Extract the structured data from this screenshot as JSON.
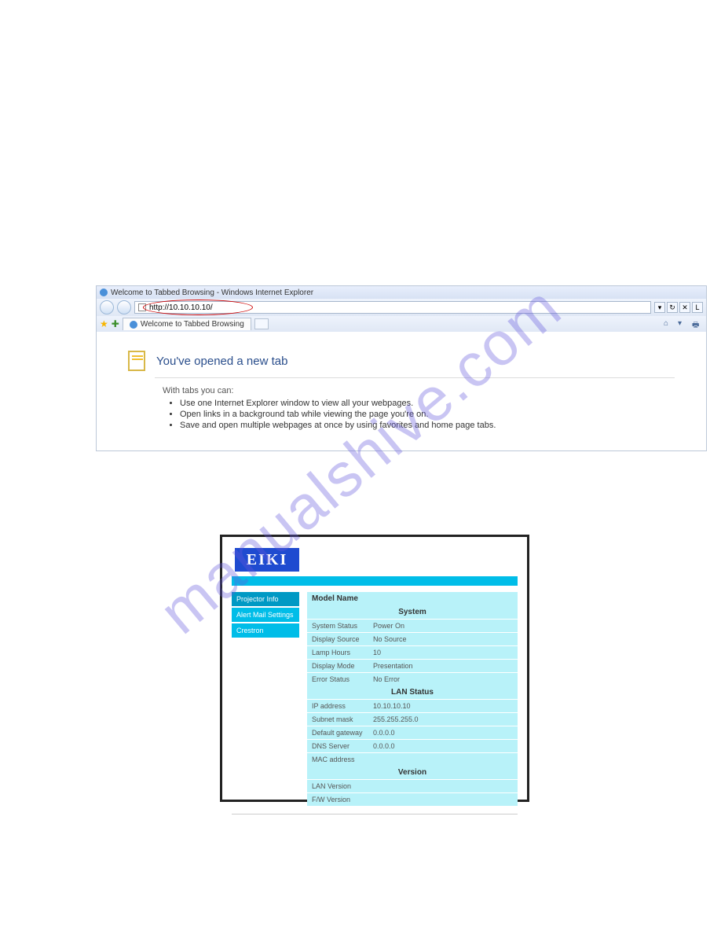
{
  "watermark": "manualshive.com",
  "browser": {
    "title": "Welcome to Tabbed Browsing - Windows Internet Explorer",
    "url": "http://10.10.10.10/",
    "refresh_icon": "↻",
    "stop_icon": "✕",
    "search_hint": "L",
    "tab_label": "Welcome to Tabbed Browsing",
    "toolbar": {
      "home": "⌂",
      "print": "🖶"
    },
    "page": {
      "heading": "You've opened a new tab",
      "intro": "With tabs you can:",
      "bullets": [
        "Use one Internet Explorer window to view all your webpages.",
        "Open links in a background tab while viewing the page you're on.",
        "Save and open multiple webpages at once by using favorites and home page tabs."
      ]
    }
  },
  "projector": {
    "logo": "EIKI",
    "sidebar": [
      "Projector Info",
      "Alert Mail Settings",
      "Crestron"
    ],
    "model_label": "Model Name",
    "section_system": "System",
    "section_lan": "LAN Status",
    "section_version": "Version",
    "rows": {
      "system_status_l": "System Status",
      "system_status_v": "Power On",
      "display_source_l": "Display Source",
      "display_source_v": "No Source",
      "lamp_hours_l": "Lamp Hours",
      "lamp_hours_v": "10",
      "display_mode_l": "Display Mode",
      "display_mode_v": "Presentation",
      "error_status_l": "Error Status",
      "error_status_v": "No Error",
      "ip_l": "IP address",
      "ip_v": "10.10.10.10",
      "subnet_l": "Subnet mask",
      "subnet_v": "255.255.255.0",
      "gw_l": "Default gateway",
      "gw_v": "0.0.0.0",
      "dns_l": "DNS Server",
      "dns_v": "0.0.0.0",
      "mac_l": "MAC address",
      "mac_v": "",
      "lanver_l": "LAN Version",
      "lanver_v": "",
      "fwver_l": "F/W Version",
      "fwver_v": ""
    }
  }
}
